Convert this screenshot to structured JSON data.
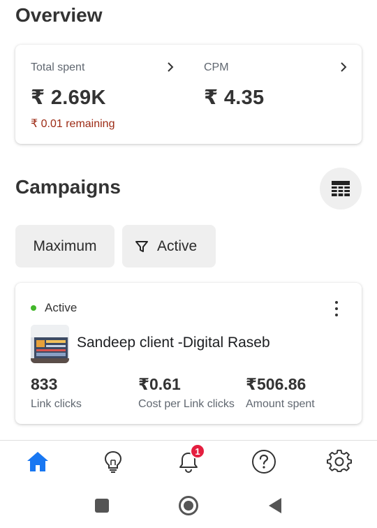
{
  "overview": {
    "title": "Overview",
    "total_spent": {
      "label": "Total spent",
      "value": "₹ 2.69K",
      "sub": "₹ 0.01 remaining"
    },
    "cpm": {
      "label": "CPM",
      "value": "₹ 4.35"
    }
  },
  "campaigns": {
    "title": "Campaigns",
    "filters": {
      "sort_label": "Maximum",
      "status_label": "Active"
    },
    "card": {
      "status": "Active",
      "name": "Sandeep client -Digital Raseb",
      "stats": [
        {
          "value": "833",
          "label": "Link clicks"
        },
        {
          "value": "₹0.61",
          "label": "Cost per Link clicks"
        },
        {
          "value": "₹506.86",
          "label": "Amount spent"
        }
      ]
    }
  },
  "tabs": {
    "items": [
      "home-icon",
      "lightbulb-icon",
      "bell-icon",
      "help-icon",
      "gear-icon"
    ],
    "notification_badge": "1",
    "active": "home"
  },
  "colors": {
    "accent": "#1877f2",
    "active_dot": "#42b72a",
    "remaining": "#9c2a14",
    "badge": "#e41e3f"
  }
}
